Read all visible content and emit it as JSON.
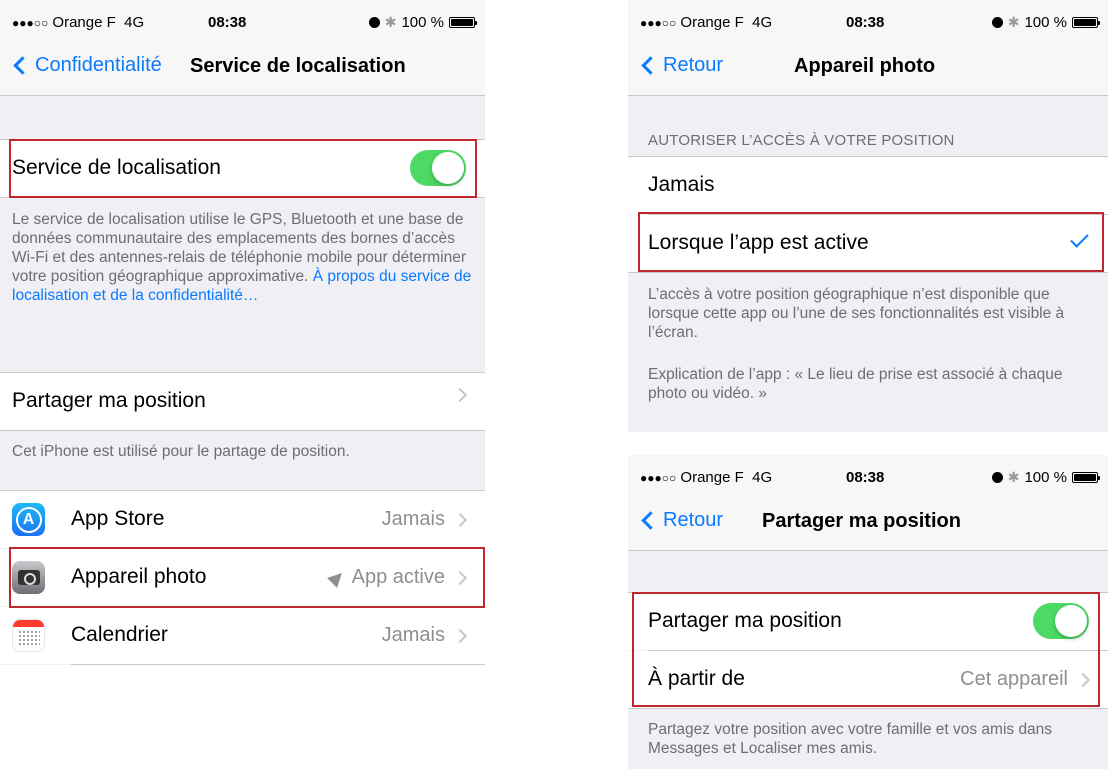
{
  "left": {
    "status": {
      "carrier": "Orange F",
      "network": "4G",
      "time": "08:38",
      "battery": "100 %"
    },
    "nav": {
      "back_label": "Confidentialité",
      "title": "Service de localisation"
    },
    "location_toggle_label": "Service de localisation",
    "location_toggle_on": true,
    "description": "Le service de localisation utilise le GPS, Bluetooth et une base de données communautaire des emplacements des bornes d’accès Wi-Fi et des antennes-relais de téléphonie mobile pour déterminer votre position géographique approximative.",
    "description_link": "À propos du service de localisation et de la confidentialité…",
    "share_row_label": "Partager ma position",
    "share_footnote": "Cet iPhone est utilisé pour le partage de position.",
    "apps": [
      {
        "name": "App Store",
        "status": "Jamais",
        "icon": "app-store-icon"
      },
      {
        "name": "Appareil photo",
        "status": "App active",
        "icon": "camera-icon"
      },
      {
        "name": "Calendrier",
        "status": "Jamais",
        "icon": "calendar-icon"
      }
    ]
  },
  "top_right": {
    "status": {
      "carrier": "Orange F",
      "network": "4G",
      "time": "08:38",
      "battery": "100 %"
    },
    "nav": {
      "back_label": "Retour",
      "title": "Appareil photo"
    },
    "section_header": "AUTORISER L’ACCÈS À VOTRE POSITION",
    "options": [
      {
        "label": "Jamais",
        "selected": false
      },
      {
        "label": "Lorsque l’app est active",
        "selected": true
      }
    ],
    "footnote_1": "L’accès à votre position géographique n’est disponible que lorsque cette app ou l’une de ses fonctionnalités est visible à l’écran.",
    "footnote_2": "Explication de l’app : « Le lieu de prise est associé à chaque photo ou vidéo. »"
  },
  "bottom_right": {
    "status": {
      "carrier": "Orange F",
      "network": "4G",
      "time": "08:38",
      "battery": "100 %"
    },
    "nav": {
      "back_label": "Retour",
      "title": "Partager ma position"
    },
    "toggle_label": "Partager ma position",
    "toggle_on": true,
    "from_label": "À partir de",
    "from_value": "Cet appareil",
    "footnote": "Partagez votre position avec votre famille et vos amis dans Messages et Localiser mes amis."
  },
  "colors": {
    "accent": "#0a7aff",
    "toggle_on": "#4cd964",
    "highlight": "#c0282d",
    "background": "#efeff4"
  }
}
